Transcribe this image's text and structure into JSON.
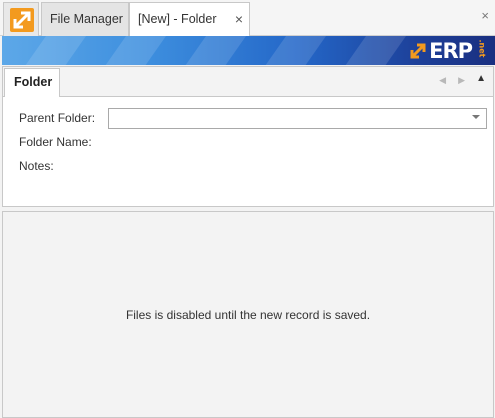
{
  "tabs": {
    "file_manager": "File Manager",
    "new_folder": "[New] - Folder",
    "close_glyph": "×",
    "strip_close_glyph": "×"
  },
  "banner": {
    "logo_text": "ERP",
    "logo_suffix": ".net",
    "accent_color": "#f39a1e",
    "brand_color": "#1d3f98"
  },
  "panel": {
    "tab_label": "Folder",
    "nav_prev_glyph": "◀",
    "nav_next_glyph": "▶",
    "collapse_glyph": "▲"
  },
  "form": {
    "parent_folder_label": "Parent Folder:",
    "parent_folder_value": "",
    "folder_name_label": "Folder Name:",
    "notes_label": "Notes:"
  },
  "files": {
    "message": "Files is disabled until the new record is saved."
  }
}
